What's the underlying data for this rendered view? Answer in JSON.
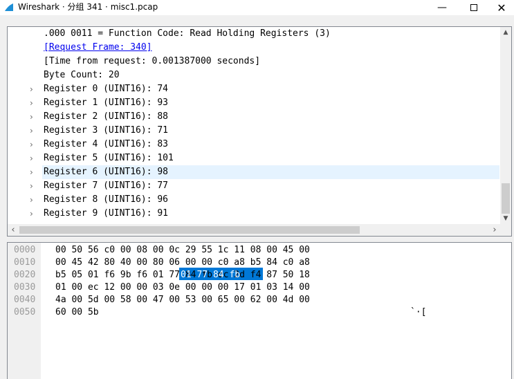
{
  "window": {
    "title": "Wireshark · 分组 341 · misc1.pcap",
    "minimize_glyph": "—",
    "maximize_glyph": "☐",
    "close_glyph": "✕",
    "accent_color": "#1e8fd6"
  },
  "packet_details": {
    "lines": [
      {
        "text": ".000 0011 = Function Code: Read Holding Registers (3)",
        "expandable": false
      },
      {
        "text": "[Request Frame: 340]",
        "expandable": false,
        "link": true
      },
      {
        "text": "[Time from request: 0.001387000 seconds]",
        "expandable": false
      },
      {
        "text": "Byte Count: 20",
        "expandable": false
      },
      {
        "text": "Register 0 (UINT16): 74",
        "expandable": true
      },
      {
        "text": "Register 1 (UINT16): 93",
        "expandable": true
      },
      {
        "text": "Register 2 (UINT16): 88",
        "expandable": true
      },
      {
        "text": "Register 3 (UINT16): 71",
        "expandable": true
      },
      {
        "text": "Register 4 (UINT16): 83",
        "expandable": true
      },
      {
        "text": "Register 5 (UINT16): 101",
        "expandable": true
      },
      {
        "text": "Register 6 (UINT16): 98",
        "expandable": true,
        "selected": true
      },
      {
        "text": "Register 7 (UINT16): 77",
        "expandable": true
      },
      {
        "text": "Register 8 (UINT16): 96",
        "expandable": true
      },
      {
        "text": "Register 9 (UINT16): 91",
        "expandable": true
      }
    ],
    "chevron_glyph": "›",
    "selected_color": "#e5f3ff"
  },
  "packet_bytes": {
    "rows": [
      {
        "offset": "0000",
        "hex": "00 50 56 c0 00 08 00 0c  29 55 1c 11 08 00 45 00",
        "ascii": ""
      },
      {
        "offset": "0010",
        "hex": "00 45 42 80 40 00 80 06  00 00 c0 a8 b5 84 c0 a8",
        "ascii": ""
      },
      {
        "offset": "0020",
        "hex": "b5 05 01 f6 9b f6 01 77  84 fb dc 2d f4 87 50 18",
        "ascii": ""
      },
      {
        "offset": "0030",
        "hex": "01 00 ec 12 00 00 03 0e  00 00 00 17 01 03 14 00",
        "ascii": ""
      },
      {
        "offset": "0040",
        "hex": "4a 00 5d 00 58 00 47 00  53 00 65 00 62 00 4d 00",
        "ascii": ""
      },
      {
        "offset": "0050",
        "hex": "60 00 5b",
        "ascii": "`·["
      }
    ],
    "highlight_text": "01 77  84 fb",
    "highlight_color": "#0078d7"
  }
}
